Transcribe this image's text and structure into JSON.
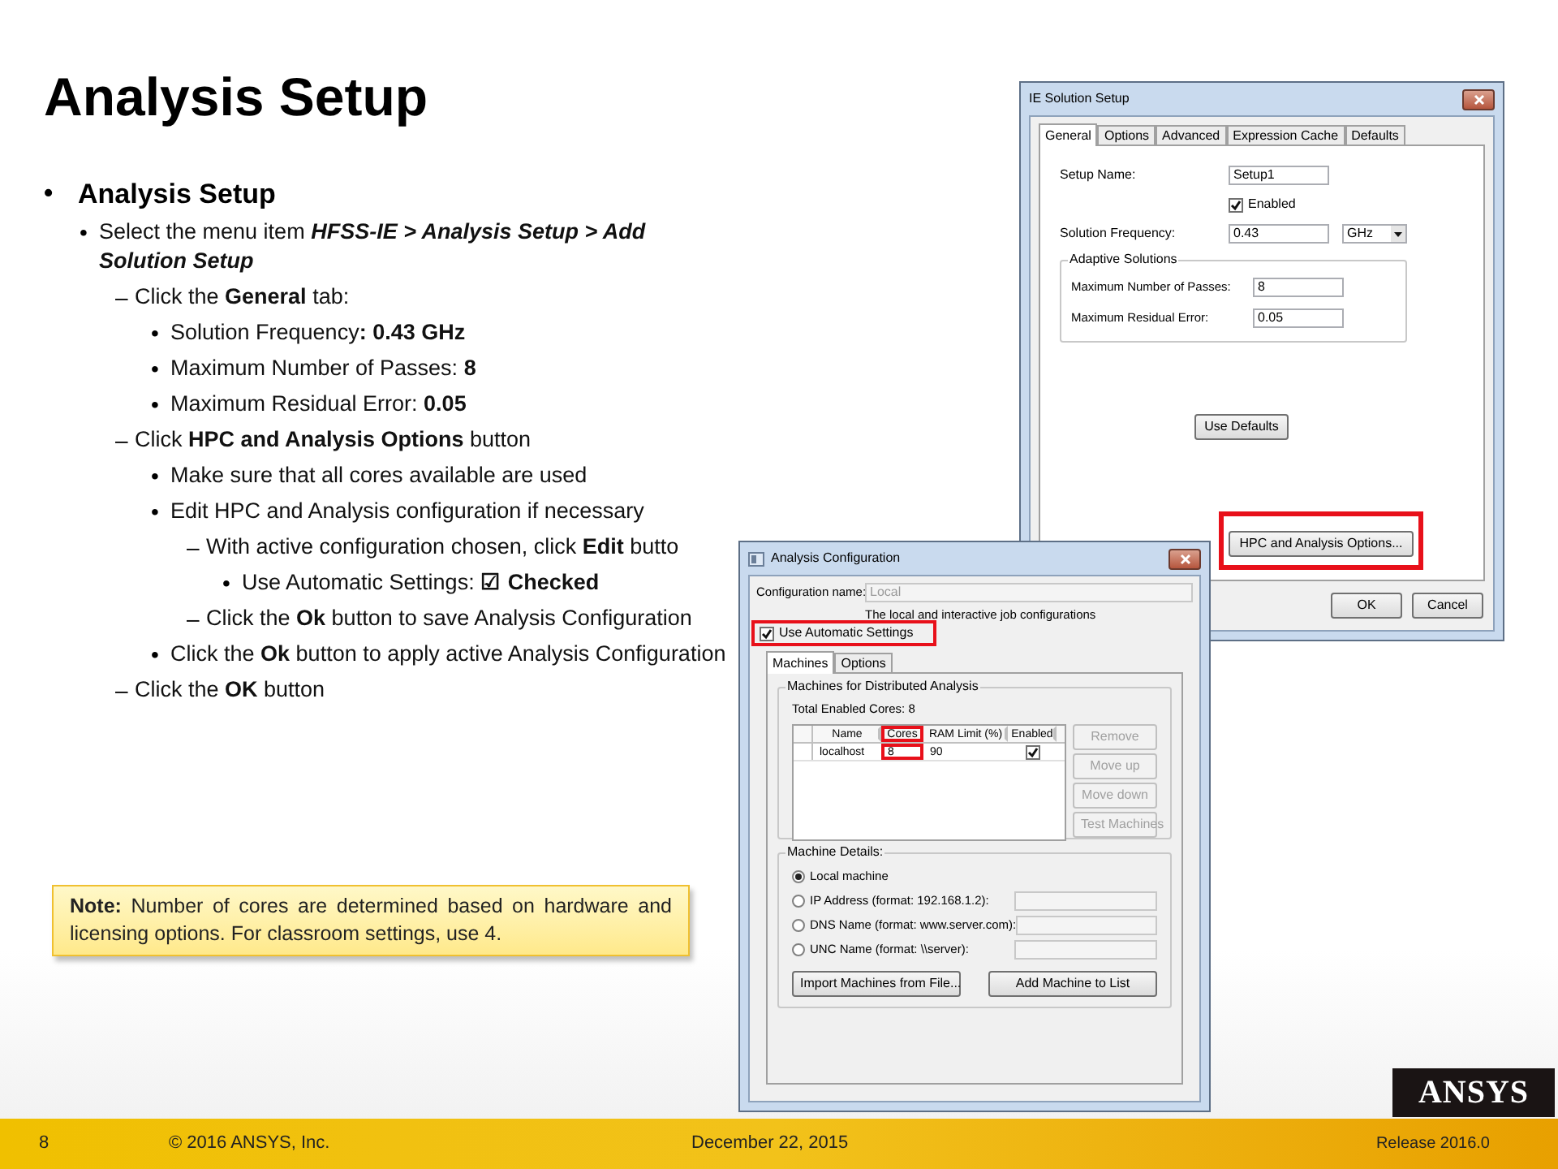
{
  "slide": {
    "title": "Analysis Setup"
  },
  "bullets": [
    {
      "marker": "•",
      "text": "Analysis Setup",
      "kind": "heading",
      "children": [
        {
          "marker": "•",
          "text": "Select the menu item ",
          "emphasis": "HFSS-IE > Analysis Setup > Add Solution Setup",
          "kind": "item",
          "children": [
            {
              "marker": "–",
              "text": "Click the **General** tab:",
              "kind": "item",
              "children": [
                {
                  "marker": "•",
                  "text": "Solution Frequency**: 0.43 GHz**",
                  "kind": "item"
                },
                {
                  "marker": "•",
                  "text": "Maximum Number of Passes: **8**",
                  "kind": "item"
                },
                {
                  "marker": "•",
                  "text": "Maximum Residual Error: **0.05**",
                  "kind": "item"
                }
              ]
            },
            {
              "marker": "–",
              "text": "Click **HPC and Analysis Options** button",
              "kind": "item",
              "children": [
                {
                  "marker": "•",
                  "text": "Make sure that all cores available are used",
                  "kind": "item"
                },
                {
                  "marker": "•",
                  "text": "Edit HPC and Analysis configuration if necessary",
                  "kind": "item",
                  "children": [
                    {
                      "marker": "–",
                      "text": "With active configuration chosen, click **Edit** butto",
                      "kind": "item",
                      "children": [
                        {
                          "marker": "•",
                          "text": "Use Automatic Settings: **☑ Checked**",
                          "kind": "item"
                        }
                      ]
                    },
                    {
                      "marker": "–",
                      "text": "Click the **Ok** button to save Analysis Configuration",
                      "kind": "item"
                    }
                  ]
                },
                {
                  "marker": "•",
                  "text": "Click the **Ok** button to apply active Analysis Configuration",
                  "kind": "item"
                }
              ]
            },
            {
              "marker": "–",
              "text": "Click the **OK** button",
              "kind": "item"
            }
          ]
        }
      ]
    }
  ],
  "note": "**Note:** Number of cores are determined based on hardware and licensing options. For classroom settings, use 4.",
  "solution_setup": {
    "title": "IE Solution Setup",
    "tabs": [
      {
        "label": "General",
        "selected": true
      },
      {
        "label": "Options",
        "selected": false
      },
      {
        "label": "Advanced",
        "selected": false
      },
      {
        "label": "Expression Cache",
        "selected": false
      },
      {
        "label": "Defaults",
        "selected": false
      }
    ],
    "setup_name": {
      "label": "Setup Name:",
      "value": "Setup1"
    },
    "enabled": {
      "label": "Enabled",
      "checked": true
    },
    "frequency": {
      "label": "Solution Frequency:",
      "value": "0.43",
      "unit": "GHz"
    },
    "adaptive": {
      "title": "Adaptive Solutions",
      "fields": [
        {
          "label": "Maximum Number of Passes:",
          "value": "8"
        },
        {
          "label": "Maximum Residual Error:",
          "value": "0.05"
        }
      ]
    },
    "use_defaults": "Use Defaults",
    "hpc_button": {
      "label": "HPC and Analysis Options...",
      "highlighted": true
    },
    "buttons": [
      "OK",
      "Cancel"
    ]
  },
  "analysis_config": {
    "title": "Analysis Configuration",
    "config_name": {
      "label": "Configuration name:",
      "value": "Local",
      "disabled": true
    },
    "description": "The local and interactive job configurations",
    "auto_settings": {
      "label": "Use Automatic Settings",
      "checked": true,
      "highlighted": true
    },
    "tabs": [
      {
        "label": "Machines",
        "selected": true
      },
      {
        "label": "Options",
        "selected": false
      }
    ],
    "machines": {
      "title": "Machines for Distributed Analysis",
      "total": "Total Enabled Cores: 8",
      "columns": [
        {
          "label": "Name",
          "highlighted": false
        },
        {
          "label": "Cores",
          "highlighted": true
        },
        {
          "label": "RAM Limit (%)",
          "highlighted": false
        },
        {
          "label": "Enabled",
          "highlighted": false
        }
      ],
      "rows": [
        {
          "cells": [
            "localhost",
            "8",
            "90"
          ],
          "enabled": true
        }
      ],
      "buttons": [
        {
          "label": "Remove",
          "disabled": true
        },
        {
          "label": "Move up",
          "disabled": true
        },
        {
          "label": "Move down",
          "disabled": true
        },
        {
          "label": "Test Machines",
          "disabled": true
        }
      ]
    },
    "details": {
      "title": "Machine Details:",
      "options": [
        {
          "label": "Local machine",
          "selected": true,
          "has_field": false
        },
        {
          "label": "IP Address (format: 192.168.1.2):",
          "selected": false,
          "has_field": true
        },
        {
          "label": "DNS Name (format: www.server.com):",
          "selected": false,
          "has_field": true
        },
        {
          "label": "UNC Name (format: \\\\server):",
          "selected": false,
          "has_field": true
        }
      ],
      "buttons": [
        "Import Machines from File...",
        "Add Machine to List"
      ]
    }
  },
  "footer": {
    "page": "8",
    "copyright": "© 2016 ANSYS,  Inc.",
    "date": "December  22, 2015",
    "logo": "ANSYS",
    "release": "Release 2016.0"
  }
}
